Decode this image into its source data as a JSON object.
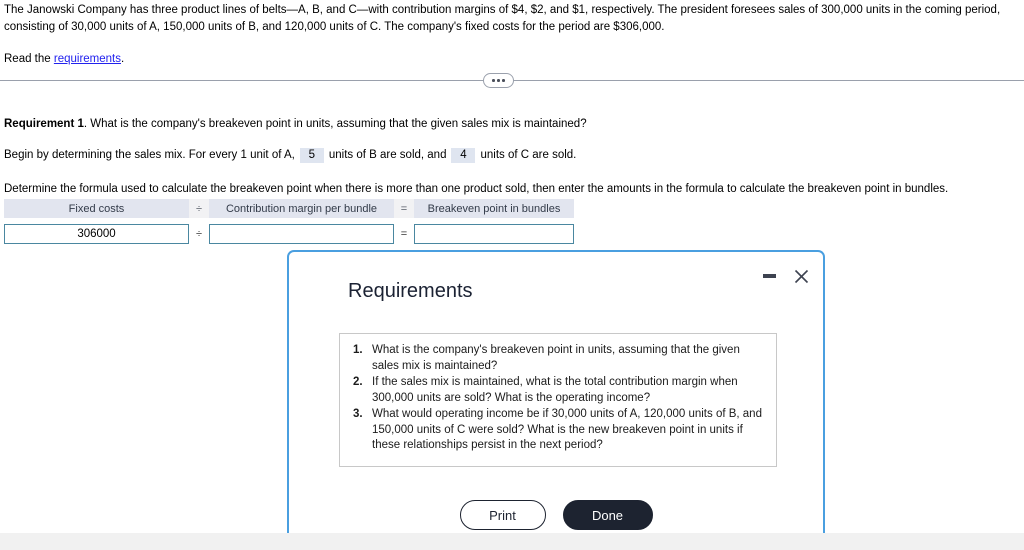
{
  "problem": {
    "statement": "The Janowski Company has three product lines of belts—A, B, and C—with contribution margins of $4, $2, and $1, respectively. The president foresees sales of 300,000 units in the coming period, consisting of 30,000 units of A, 150,000 units of B, and 120,000 units of C. The company's fixed costs for the period are $306,000.",
    "read_prefix": "Read the ",
    "read_link": "requirements",
    "read_suffix": "."
  },
  "divider": {
    "expander_icon": "ellipsis-icon"
  },
  "requirement": {
    "label": "Requirement 1",
    "question": ". What is the company's breakeven point in units, assuming that the given sales mix is maintained?",
    "mix_prefix": "Begin by determining the sales mix. For every 1 unit of A,",
    "mix_value_b": "5",
    "mix_middle": "units of B are sold, and",
    "mix_value_c": "4",
    "mix_suffix": "units of C are sold.",
    "determine": "Determine the formula used to calculate the breakeven point when there is more than one product sold, then enter the amounts in the formula to calculate the breakeven point in bundles."
  },
  "formula_table": {
    "headers": {
      "fixed_costs": "Fixed costs",
      "op1": "÷",
      "contribution_margin": "Contribution margin per bundle",
      "op2": "=",
      "breakeven": "Breakeven point in bundles"
    },
    "inputs": {
      "fixed_costs_value": "306000",
      "fixed_costs_placeholder": "",
      "contribution_margin_value": "",
      "contribution_margin_placeholder": "",
      "breakeven_value": "",
      "breakeven_placeholder": ""
    },
    "operators": {
      "op1": "÷",
      "op2": "="
    }
  },
  "modal": {
    "title": "Requirements",
    "minimize_icon": "minimize-icon",
    "close_icon": "close-icon",
    "items": [
      {
        "num": "1.",
        "text": "What is the company's breakeven point in units, assuming that the given sales mix is maintained?"
      },
      {
        "num": "2.",
        "text": "If the sales mix is maintained, what is the total contribution margin when 300,000 units are sold? What is the operating income?"
      },
      {
        "num": "3.",
        "text": "What would operating income be if 30,000 units of A, 120,000 units of B, and 150,000 units of C were sold? What is the new breakeven point in units if these relationships persist in the next period?"
      }
    ],
    "print_label": "Print",
    "done_label": "Done"
  },
  "colors": {
    "link": "#2222ee",
    "modal_border": "#4a9fe0",
    "done_button": "#1d2330",
    "answer_box": "#dfe5f0",
    "table_header": "#e2e5ef",
    "input_border": "#4a87a0"
  }
}
